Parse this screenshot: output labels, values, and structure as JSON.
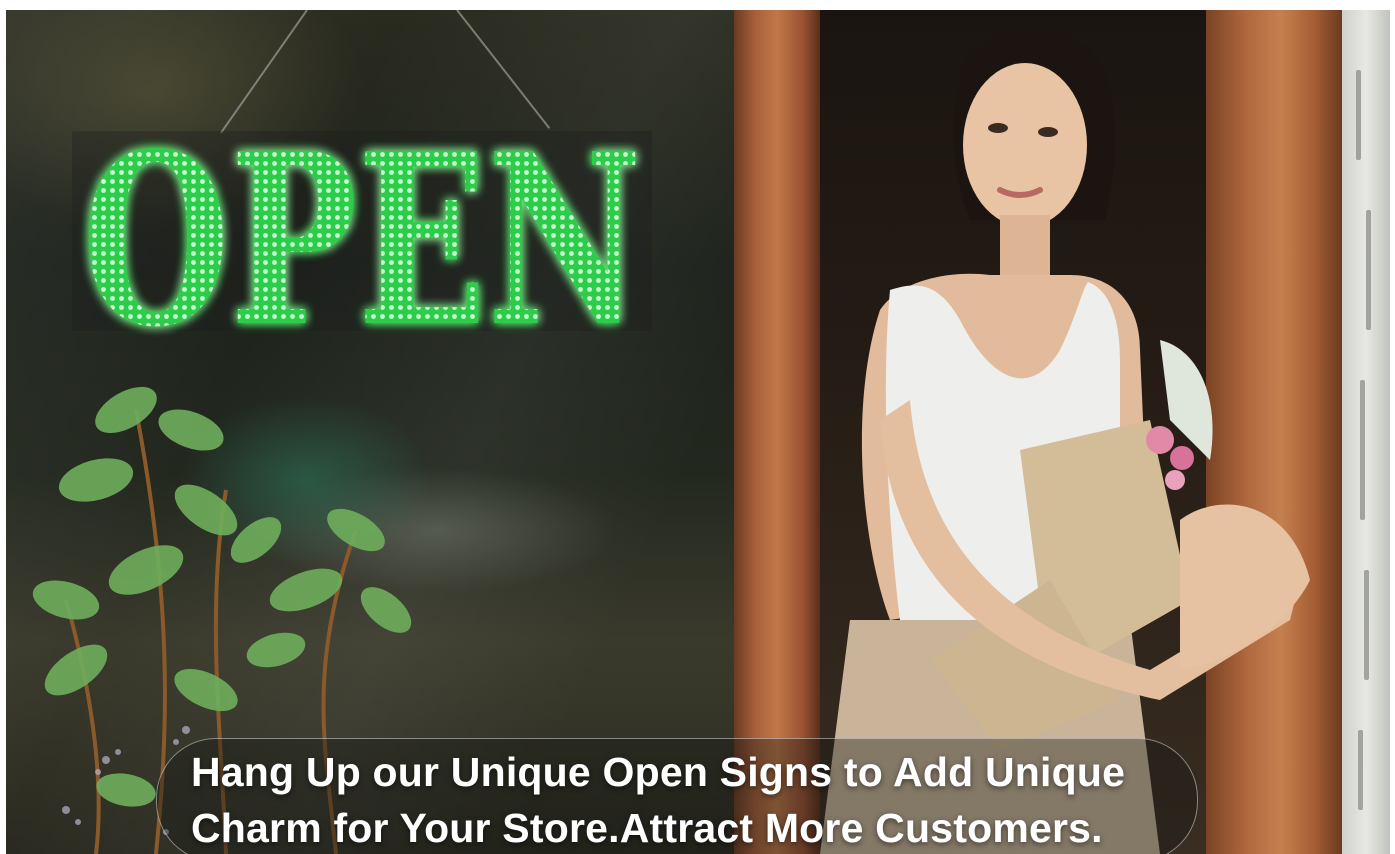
{
  "sign": {
    "text": "OPEN",
    "color": "#3fe05a"
  },
  "caption": {
    "line1": "Hang Up our Unique Open Signs to Add Unique",
    "line2": "Charm for Your Store.Attract More Customers."
  },
  "colors": {
    "frame_wood": "#b0683e",
    "caption_text": "#ffffff"
  }
}
